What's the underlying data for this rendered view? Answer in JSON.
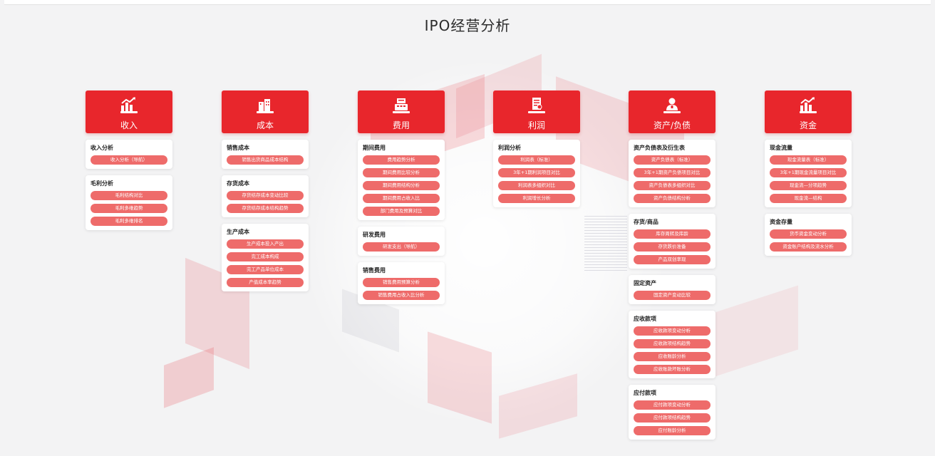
{
  "page": {
    "title": "IPO经营分析"
  },
  "columns": [
    {
      "key": "revenue",
      "title": "收入",
      "icon": "revenue-chart-icon",
      "sections": [
        {
          "title": "收入分析",
          "items": [
            "收入分析（导航）"
          ]
        },
        {
          "title": "毛利分析",
          "items": [
            "毛利结构对比",
            "毛利多维趋势",
            "毛利多维排名"
          ]
        }
      ]
    },
    {
      "key": "cost",
      "title": "成本",
      "icon": "cost-building-icon",
      "sections": [
        {
          "title": "销售成本",
          "items": [
            "销售出货商品成本结构"
          ]
        },
        {
          "title": "存货成本",
          "items": [
            "存货结存成本变动比较",
            "存货结存成本结构趋势"
          ]
        },
        {
          "title": "生产成本",
          "items": [
            "生产成本投入产出",
            "完工成本构成",
            "完工产品单位成本",
            "产值成本率趋势"
          ]
        }
      ]
    },
    {
      "key": "expense",
      "title": "费用",
      "icon": "expense-register-icon",
      "sections": [
        {
          "title": "期间费用",
          "items": [
            "费用趋势分析",
            "期间费用比较分析",
            "期间费用结构分析",
            "期间费用占收入比",
            "部门费用及预算对比"
          ]
        },
        {
          "title": "研发费用",
          "items": [
            "研发支出（导航）"
          ]
        },
        {
          "title": "销售费用",
          "items": [
            "销售费用预算分析",
            "销售费用占收入比分析"
          ]
        }
      ]
    },
    {
      "key": "profit",
      "title": "利润",
      "icon": "profit-report-icon",
      "sections": [
        {
          "title": "利润分析",
          "items": [
            "利润表（标准）",
            "3年+1期利润项目对比",
            "利润表多组织对比",
            "利润增长分析"
          ]
        }
      ]
    },
    {
      "key": "assets",
      "title": "资产/负债",
      "icon": "assets-person-icon",
      "sections": [
        {
          "title": "资产负债表及衍生表",
          "items": [
            "资产负债表（标准）",
            "3年+1期资产负债项目对比",
            "资产负债表多组织对比",
            "资产负债结构分析"
          ]
        },
        {
          "title": "存货/商品",
          "items": [
            "库存周转及库龄",
            "存货跌价准备",
            "产品双创率现"
          ]
        },
        {
          "title": "固定资产",
          "items": [
            "固定资产变动比较"
          ]
        },
        {
          "title": "应收款项",
          "items": [
            "应收款项变动分析",
            "应收款项结构趋势",
            "应收账龄分析",
            "应收账款坏账分析"
          ]
        },
        {
          "title": "应付款项",
          "items": [
            "应付款项变动分析",
            "应付款项结构趋势",
            "应付账龄分析"
          ]
        }
      ]
    },
    {
      "key": "funds",
      "title": "资金",
      "icon": "funds-chart-icon",
      "sections": [
        {
          "title": "现金流量",
          "items": [
            "现金流量表（标准）",
            "3年+1期现金流量项目对比",
            "现金流—分项趋势",
            "现金流—结构"
          ]
        },
        {
          "title": "资金存量",
          "items": [
            "货币资金变动分析",
            "资金账户结构及流水分析"
          ]
        }
      ]
    }
  ],
  "colors": {
    "header": "#e8262c",
    "pill": "#ee6b6a",
    "card": "#ffffff",
    "background": "#f3f3f4"
  }
}
